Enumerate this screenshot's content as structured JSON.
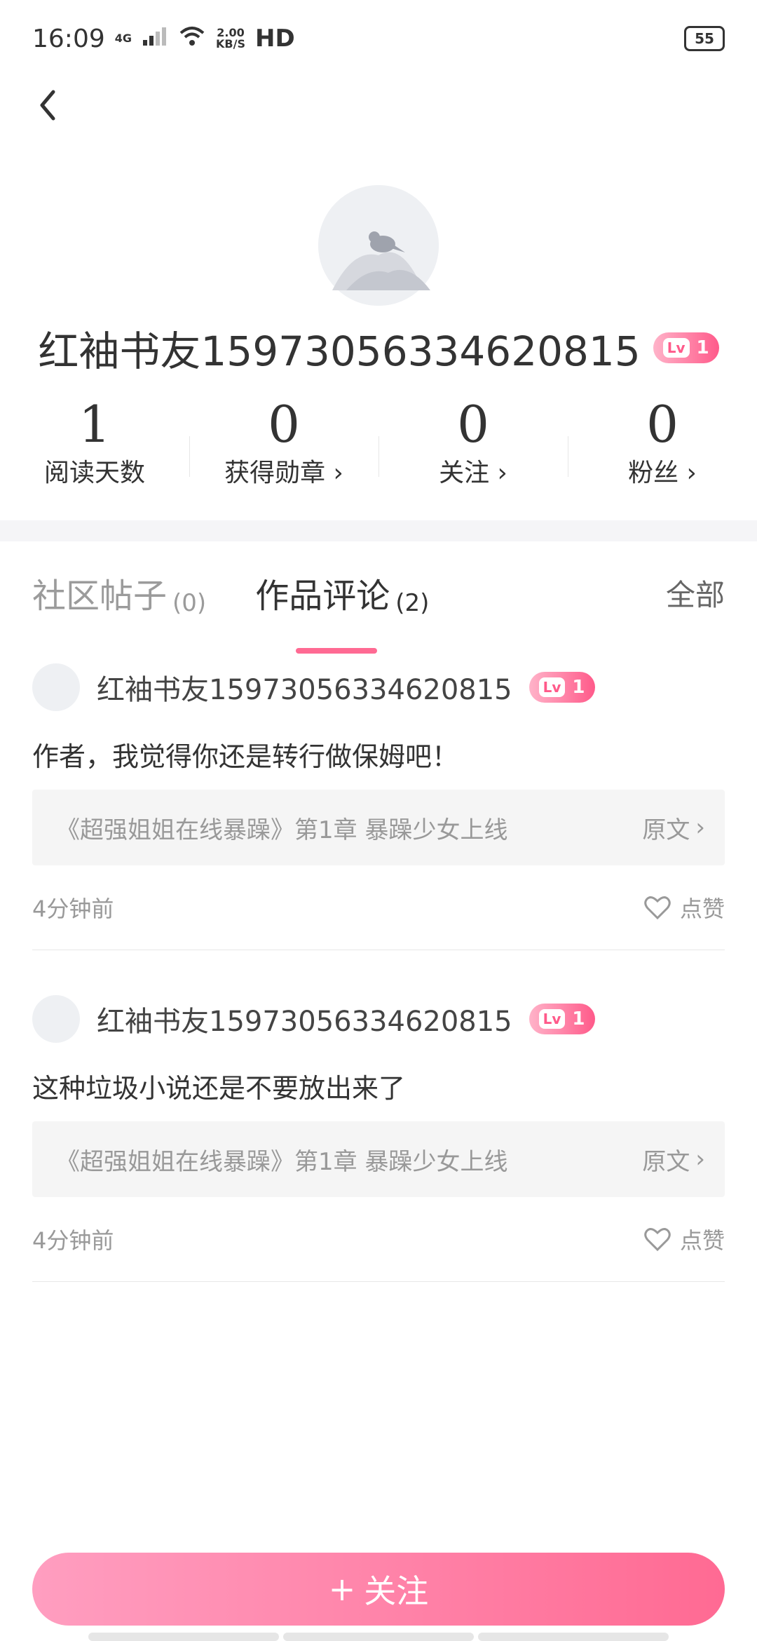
{
  "status_bar": {
    "time": "16:09",
    "network": "4G",
    "speed_top": "2.00",
    "speed_bottom": "KB/S",
    "hd": "HD",
    "battery": "55"
  },
  "profile": {
    "username": "红袖书友15973056334620815",
    "level_lv": "Lv",
    "level_num": "1",
    "stats": [
      {
        "value": "1",
        "label": "阅读天数"
      },
      {
        "value": "0",
        "label": "获得勋章 ›"
      },
      {
        "value": "0",
        "label": "关注 ›"
      },
      {
        "value": "0",
        "label": "粉丝 ›"
      }
    ]
  },
  "tabs": {
    "items": [
      {
        "label": "社区帖子",
        "count": "(0)"
      },
      {
        "label": "作品评论",
        "count": "(2)"
      }
    ],
    "all_label": "全部"
  },
  "comments": [
    {
      "username": "红袖书友15973056334620815",
      "level_lv": "Lv",
      "level_num": "1",
      "text": "作者，我觉得你还是转行做保姆吧！",
      "quote": "《超强姐姐在线暴躁》第1章 暴躁少女上线",
      "origin_label": "原文",
      "time": "4分钟前",
      "like_label": "点赞"
    },
    {
      "username": "红袖书友15973056334620815",
      "level_lv": "Lv",
      "level_num": "1",
      "text": "这种垃圾小说还是不要放出来了",
      "quote": "《超强姐姐在线暴躁》第1章 暴躁少女上线",
      "origin_label": "原文",
      "time": "4分钟前",
      "like_label": "点赞"
    }
  ],
  "follow_button": {
    "icon": "+",
    "label": "关注"
  },
  "colors": {
    "accent": "#ff6a93",
    "accent_light": "#ff9ec0"
  }
}
